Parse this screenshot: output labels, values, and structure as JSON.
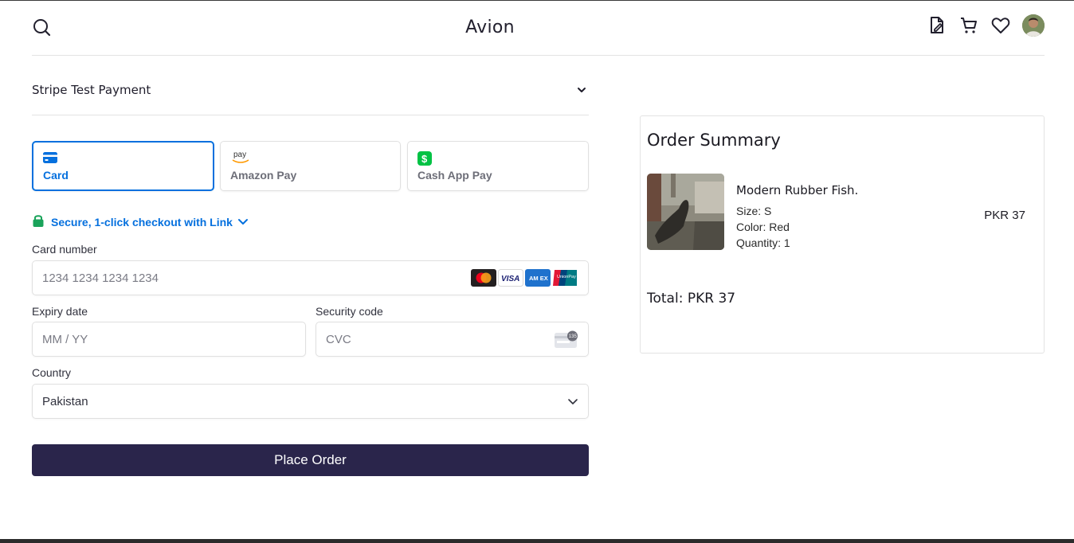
{
  "header": {
    "brand": "Avion",
    "icons": [
      "search-icon",
      "file-edit-icon",
      "cart-icon",
      "heart-icon",
      "avatar"
    ]
  },
  "payment_section": {
    "title": "Stripe Test Payment",
    "tabs": [
      {
        "label": "Card",
        "icon": "card-icon",
        "active": true
      },
      {
        "label": "Amazon Pay",
        "icon": "amazon-pay-icon",
        "active": false,
        "icon_text": "pay"
      },
      {
        "label": "Cash App Pay",
        "icon": "cash-app-icon",
        "active": false,
        "icon_text": "$"
      }
    ],
    "link_text": "Secure, 1-click checkout with Link",
    "card_number": {
      "label": "Card number",
      "placeholder": "1234 1234 1234 1234"
    },
    "card_brands": [
      "mastercard",
      "visa",
      "amex",
      "unionpay"
    ],
    "card_brand_text": {
      "visa": "VISA",
      "amex": "AM EX",
      "unionpay": "UnionPay"
    },
    "expiry": {
      "label": "Expiry date",
      "placeholder": "MM / YY"
    },
    "security": {
      "label": "Security code",
      "placeholder": "CVC",
      "badge": "135"
    },
    "country": {
      "label": "Country",
      "value": "Pakistan"
    },
    "submit_label": "Place Order"
  },
  "order_summary": {
    "title": "Order Summary",
    "item": {
      "name": "Modern Rubber Fish.",
      "size": "Size: S",
      "color": "Color: Red",
      "quantity": "Quantity: 1",
      "price": "PKR 37"
    },
    "total": "Total: PKR 37"
  },
  "colors": {
    "accent": "#0570de",
    "primary_button": "#2a254b",
    "link_lock": "#1aa35a"
  }
}
